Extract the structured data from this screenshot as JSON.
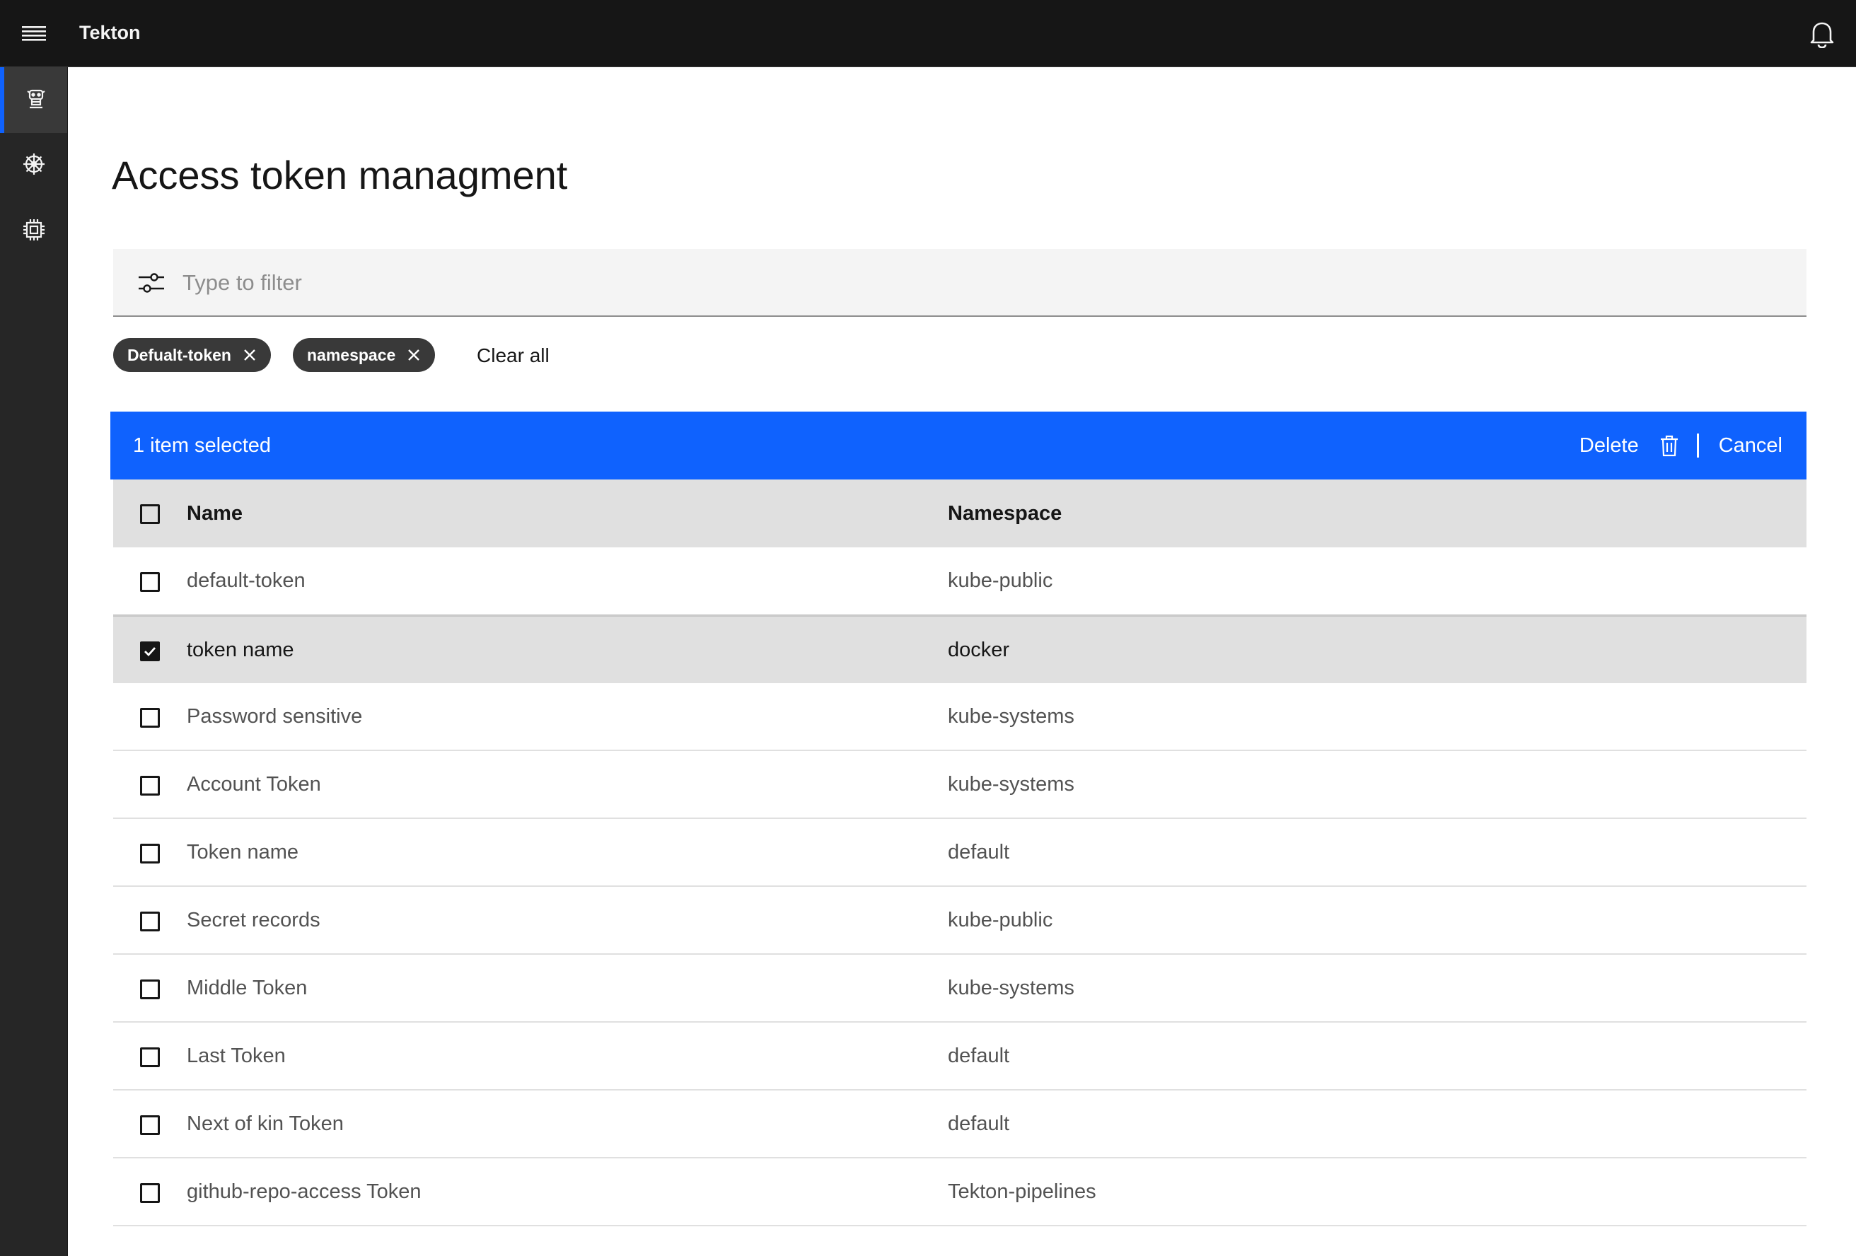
{
  "app": {
    "brand": "Tekton"
  },
  "header": {
    "menu_icon": "hamburger-menu-icon",
    "notification_icon": "bell-icon"
  },
  "rail": {
    "items": [
      {
        "icon": "tekton-robot-icon",
        "active": true
      },
      {
        "icon": "kubernetes-helm-icon",
        "active": false
      },
      {
        "icon": "chip-icon",
        "active": false
      }
    ]
  },
  "page": {
    "title": "Access token managment"
  },
  "filter": {
    "placeholder": "Type to filter",
    "value": "",
    "icon": "settings-adjust-icon"
  },
  "tags": [
    {
      "label": "Defualt-token"
    },
    {
      "label": "namespace"
    }
  ],
  "clear_all": "Clear all",
  "batch": {
    "count_label": "1 item selected",
    "delete_label": "Delete",
    "cancel_label": "Cancel",
    "accent": "#0f62fe"
  },
  "table": {
    "columns": {
      "name": "Name",
      "namespace": "Namespace"
    },
    "rows": [
      {
        "name": "default-token",
        "namespace": "kube-public",
        "selected": false
      },
      {
        "name": "token name",
        "namespace": "docker",
        "selected": true
      },
      {
        "name": "Password sensitive",
        "namespace": "kube-systems",
        "selected": false
      },
      {
        "name": "Account Token",
        "namespace": "kube-systems",
        "selected": false
      },
      {
        "name": "Token name",
        "namespace": "default",
        "selected": false
      },
      {
        "name": "Secret records",
        "namespace": "kube-public",
        "selected": false
      },
      {
        "name": "Middle Token",
        "namespace": "kube-systems",
        "selected": false
      },
      {
        "name": "Last Token",
        "namespace": "default",
        "selected": false
      },
      {
        "name": "Next of kin Token",
        "namespace": "default",
        "selected": false
      },
      {
        "name": "github-repo-access Token",
        "namespace": "Tekton-pipelines",
        "selected": false
      }
    ]
  }
}
